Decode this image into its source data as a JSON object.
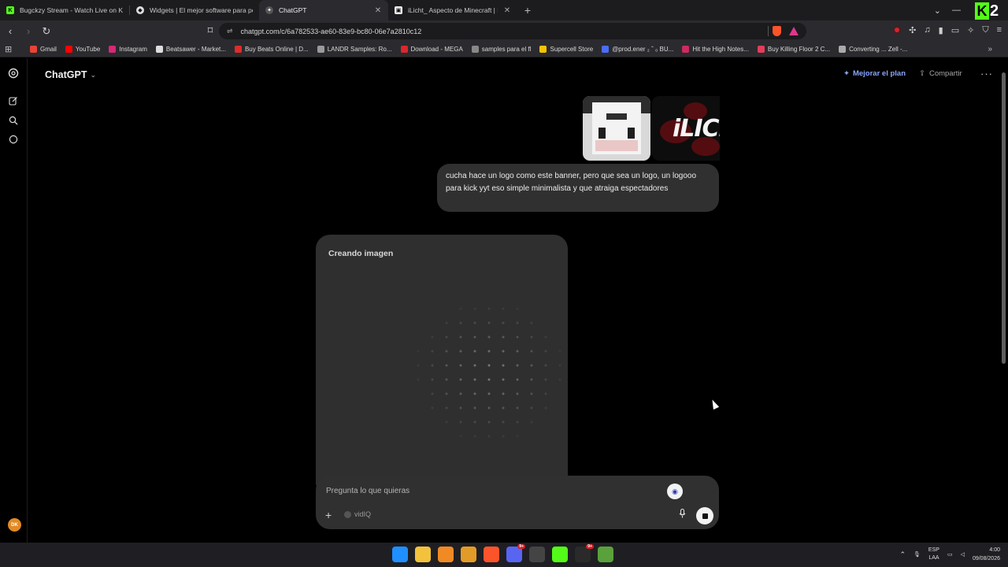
{
  "browser": {
    "tabs": [
      {
        "title": "Bugckzy Stream - Watch Live on Kick",
        "icon": "kick-icon",
        "color": "#53fc18",
        "active": false
      },
      {
        "title": "Widgets | El mejor software para pote",
        "icon": "widgets-icon",
        "color": "#dddddd",
        "active": false
      },
      {
        "title": "ChatGPT",
        "icon": "chatgpt-icon",
        "color": "#cccccc",
        "active": true
      },
      {
        "title": "iLicht_ Aspecto de Minecraft | NameM",
        "icon": "namemc-icon",
        "color": "#eeeeee",
        "active": false
      }
    ],
    "url": "chatgpt.com/c/6a782533-ae60-83e9-bc80-06e7a2810c12",
    "bookmarks": [
      {
        "label": "Gmail",
        "color": "#ea4335"
      },
      {
        "label": "YouTube",
        "color": "#ff0000"
      },
      {
        "label": "Instagram",
        "color": "#d62976"
      },
      {
        "label": "Beatsawer - Market...",
        "color": "#dddddd"
      },
      {
        "label": "Buy Beats Online | D...",
        "color": "#e02b2b"
      },
      {
        "label": "LANDR Samples: Ro...",
        "color": "#9a9a9a"
      },
      {
        "label": "Download - MEGA",
        "color": "#d9272e"
      },
      {
        "label": "samples para el fl",
        "color": "#888888"
      },
      {
        "label": "Supercell Store",
        "color": "#f4c300"
      },
      {
        "label": "@prod.ener ₂ ˆ ₀ BU...",
        "color": "#4a6cf7"
      },
      {
        "label": "Hit the High Notes...",
        "color": "#cc2b5e"
      },
      {
        "label": "Buy Killing Floor 2 C...",
        "color": "#e23d5b"
      },
      {
        "label": "Converting ... Zell -...",
        "color": "#aaaaaa"
      }
    ]
  },
  "chat": {
    "model_title": "ChatGPT",
    "upgrade_label": "Mejorar el plan",
    "share_label": "Compartir",
    "user_message": "cucha hace un logo como este banner, pero que sea un logo, un logooo para kick yyt eso  simple minimalista y que atraiga espectadores",
    "attachment_text": "iLICH",
    "creating_label": "Creando imagen",
    "composer_placeholder": "Pregunta lo que quieras",
    "composer_tool": "vidIQ",
    "avatar_initials": "DK"
  },
  "taskbar": {
    "lang_line1": "ESP",
    "lang_line2": "LAA",
    "time": "4:00",
    "date": "09/08/2026",
    "badge_count": "9+",
    "apps": [
      {
        "name": "windows-start-icon",
        "color": "#1e90ff"
      },
      {
        "name": "file-explorer-icon",
        "color": "#f3c23c"
      },
      {
        "name": "fl-studio-icon",
        "color": "#f08a24"
      },
      {
        "name": "fl-studio-2-icon",
        "color": "#e39b28"
      },
      {
        "name": "brave-icon",
        "color": "#fb542b"
      },
      {
        "name": "discord-icon",
        "color": "#5865f2"
      },
      {
        "name": "chrome-icon",
        "color": "#444444"
      },
      {
        "name": "kick-app-icon",
        "color": "#53fc18"
      },
      {
        "name": "obs-icon",
        "color": "#2a2a2a"
      },
      {
        "name": "minecraft-icon",
        "color": "#5aa13c"
      }
    ]
  }
}
